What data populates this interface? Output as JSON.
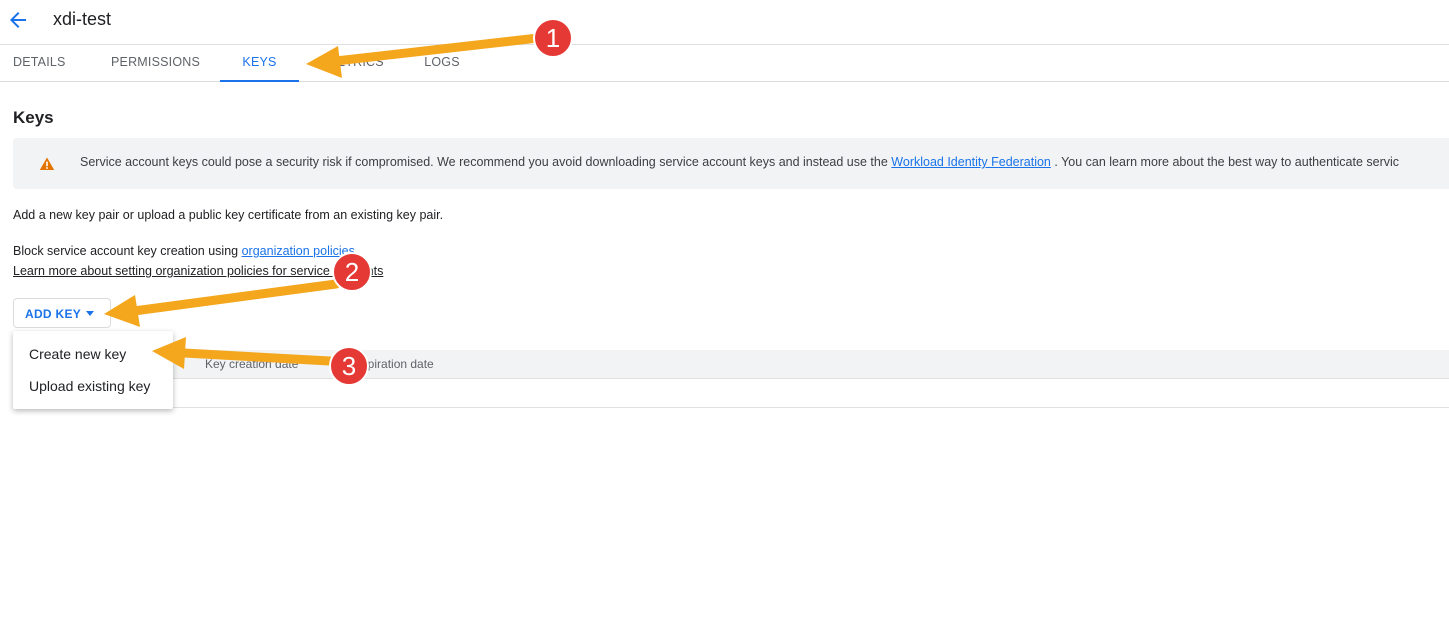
{
  "header": {
    "title": "xdi-test",
    "back_icon": "arrow-back-icon"
  },
  "tabs": [
    {
      "label": "DETAILS"
    },
    {
      "label": "PERMISSIONS"
    },
    {
      "label": "KEYS",
      "active": true
    },
    {
      "label": "METRICS"
    },
    {
      "label": "LOGS"
    }
  ],
  "section": {
    "title": "Keys"
  },
  "warning": {
    "icon": "warning-triangle-icon",
    "text_before": "Service account keys could pose a security risk if compromised. We recommend you avoid downloading service account keys and instead use the ",
    "link": "Workload Identity Federation",
    "text_after": " . You can learn more about the best way to authenticate servic"
  },
  "intro_text": "Add a new key pair or upload a public key certificate from an existing key pair.",
  "policy": {
    "text_before": "Block service account key creation using ",
    "link": "organization policies",
    "text_after": ".",
    "learn_more_link": "Learn more about setting organization policies for service accounts"
  },
  "add_key": {
    "label": "ADD KEY",
    "icon": "caret-down-icon"
  },
  "menu": {
    "items": [
      "Create new key",
      "Upload existing key"
    ]
  },
  "table": {
    "columns": [
      "Key creation date",
      "Key expiration date"
    ]
  },
  "annotations": {
    "badges": [
      "1",
      "2",
      "3"
    ],
    "color": "#f4a71d",
    "badge_color": "#e53935"
  },
  "colors": {
    "accent": "#1a73e8",
    "warning": "#e37400"
  }
}
